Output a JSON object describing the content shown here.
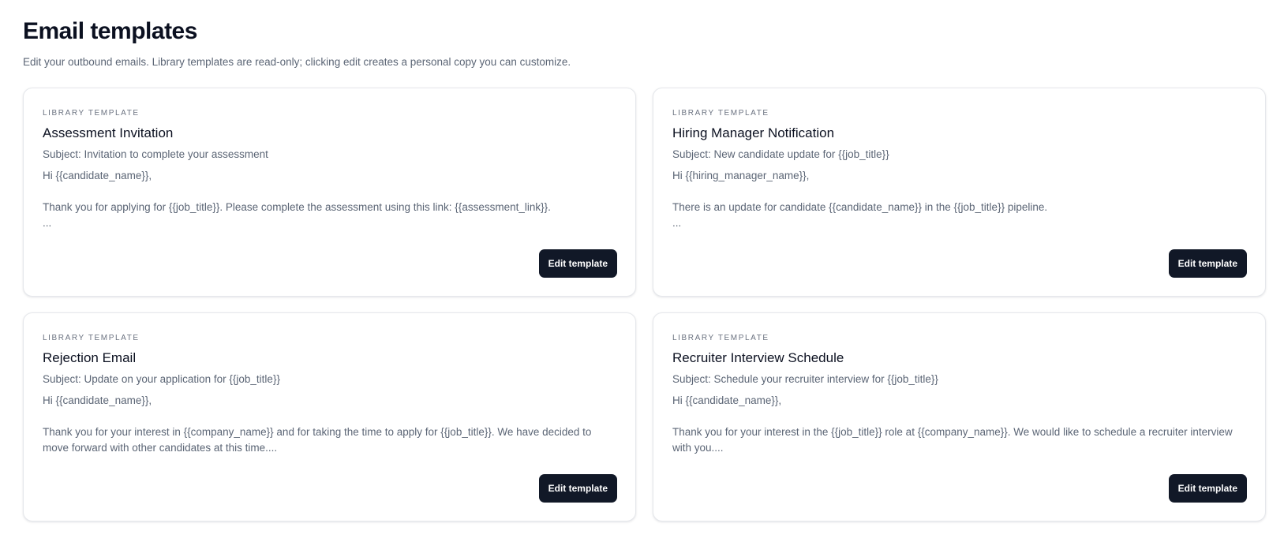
{
  "header": {
    "title": "Email templates",
    "subtitle": "Edit your outbound emails. Library templates are read-only; clicking edit creates a personal copy you can customize."
  },
  "templates": [
    {
      "kicker": "LIBRARY TEMPLATE",
      "title": "Assessment Invitation",
      "subject": "Subject: Invitation to complete your assessment",
      "body": "Hi {{candidate_name}},\n\nThank you for applying for {{job_title}}. Please complete the assessment using this link: {{assessment_link}}.\n...",
      "button_label": "Edit template"
    },
    {
      "kicker": "LIBRARY TEMPLATE",
      "title": "Hiring Manager Notification",
      "subject": "Subject: New candidate update for {{job_title}}",
      "body": "Hi {{hiring_manager_name}},\n\nThere is an update for candidate {{candidate_name}} in the {{job_title}} pipeline.\n...",
      "button_label": "Edit template"
    },
    {
      "kicker": "LIBRARY TEMPLATE",
      "title": "Rejection Email",
      "subject": "Subject: Update on your application for {{job_title}}",
      "body": "Hi {{candidate_name}},\n\nThank you for your interest in {{company_name}} and for taking the time to apply for {{job_title}}. We have decided to move forward with other candidates at this time....",
      "button_label": "Edit template"
    },
    {
      "kicker": "LIBRARY TEMPLATE",
      "title": "Recruiter Interview Schedule",
      "subject": "Subject: Schedule your recruiter interview for {{job_title}}",
      "body": "Hi {{candidate_name}},\n\nThank you for your interest in the {{job_title}} role at {{company_name}}. We would like to schedule a recruiter interview with you....",
      "button_label": "Edit template"
    }
  ]
}
